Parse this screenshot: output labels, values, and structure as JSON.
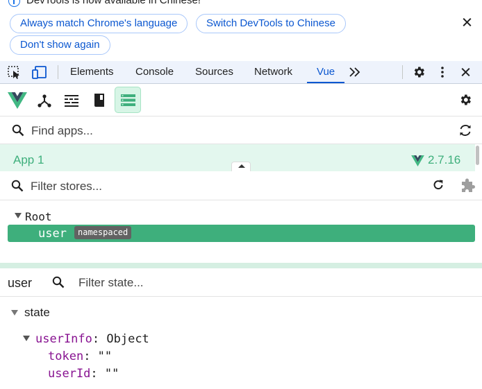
{
  "infobar": {
    "message": "DevTools is now available in Chinese!",
    "buttons": [
      "Always match Chrome's language",
      "Switch DevTools to Chinese",
      "Don't show again"
    ]
  },
  "tabs": [
    "Elements",
    "Console",
    "Sources",
    "Network",
    "Vue"
  ],
  "active_tab": "Vue",
  "apps": {
    "search_placeholder": "Find apps...",
    "app_name": "App 1",
    "vue_version": "2.7.16"
  },
  "stores": {
    "filter_placeholder": "Filter stores...",
    "root_label": "Root",
    "selected_store": "user",
    "selected_badge": "namespaced"
  },
  "state_panel": {
    "store_name": "user",
    "filter_placeholder": "Filter state...",
    "section": "state",
    "object_key": "userInfo",
    "object_type": "Object",
    "fields": [
      {
        "key": "token",
        "value": "\"\""
      },
      {
        "key": "userId",
        "value": "\"\""
      }
    ]
  },
  "colors": {
    "vue_green": "#3eaf7c",
    "accent_blue": "#0b57d0",
    "key_purple": "#881391"
  }
}
